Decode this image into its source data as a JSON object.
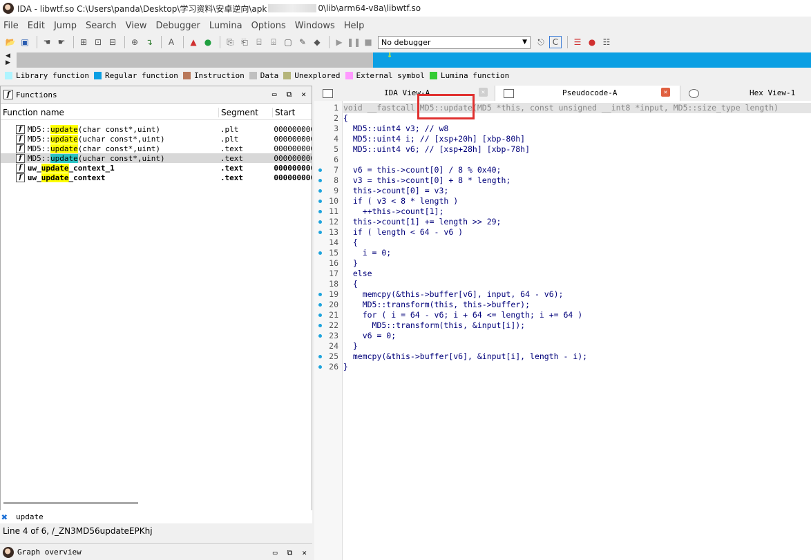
{
  "window": {
    "title": "IDA - libwtf.so C:\\Users\\panda\\Desktop\\学习资料\\安卓逆向\\apk",
    "title_tail": "0\\lib\\arm64-v8a\\libwtf.so"
  },
  "menu": [
    "File",
    "Edit",
    "Jump",
    "Search",
    "View",
    "Debugger",
    "Lumina",
    "Options",
    "Windows",
    "Help"
  ],
  "toolbar": {
    "debugger_select": "No debugger"
  },
  "legend": [
    {
      "label": "Library function",
      "color": "#aef4ff"
    },
    {
      "label": "Regular function",
      "color": "#0b9fe3"
    },
    {
      "label": "Instruction",
      "color": "#b9785a"
    },
    {
      "label": "Data",
      "color": "#c0c0c0"
    },
    {
      "label": "Unexplored",
      "color": "#b5b57a"
    },
    {
      "label": "External symbol",
      "color": "#ff99ff"
    },
    {
      "label": "Lumina function",
      "color": "#33cc33"
    }
  ],
  "functions_panel": {
    "title": "Functions",
    "columns": [
      "Function name",
      "Segment",
      "Start"
    ],
    "rows": [
      {
        "pre": "MD5::",
        "hit": "update",
        "post": "(char const*,uint)",
        "seg": ".plt",
        "start": "0000000000",
        "bold": false,
        "sel": false
      },
      {
        "pre": "MD5::",
        "hit": "update",
        "post": "(uchar const*,uint)",
        "seg": ".plt",
        "start": "0000000000",
        "bold": false,
        "sel": false
      },
      {
        "pre": "MD5::",
        "hit": "update",
        "post": "(char const*,uint)",
        "seg": ".text",
        "start": "0000000000",
        "bold": false,
        "sel": false
      },
      {
        "pre": "MD5::",
        "hit": "update",
        "post": "(uchar const*,uint)",
        "seg": ".text",
        "start": "0000000000",
        "bold": false,
        "sel": true
      },
      {
        "pre": "uw_",
        "hit": "update",
        "post": "_context_1",
        "seg": ".text",
        "start": "0000000000",
        "bold": true,
        "sel": false
      },
      {
        "pre": "uw_",
        "hit": "update",
        "post": "_context",
        "seg": ".text",
        "start": "0000000000",
        "bold": true,
        "sel": false
      }
    ],
    "filter": "update",
    "status": "Line 4 of 6, /_ZN3MD56updateEPKhj"
  },
  "graph_overview": {
    "title": "Graph overview"
  },
  "tabs": [
    {
      "label": "IDA View-A",
      "active": false
    },
    {
      "label": "Pseudocode-A",
      "active": true
    },
    {
      "label": "Hex View-1",
      "active": false
    }
  ],
  "code": [
    {
      "n": "1",
      "d": false,
      "t": "void __fastcall MD5::update(MD5 *this, const unsigned __int8 *input, MD5::size_type length)"
    },
    {
      "n": "2",
      "d": false,
      "t": "{"
    },
    {
      "n": "3",
      "d": false,
      "t": "  MD5::uint4 v3; // w8"
    },
    {
      "n": "4",
      "d": false,
      "t": "  MD5::uint4 i; // [xsp+20h] [xbp-80h]"
    },
    {
      "n": "5",
      "d": false,
      "t": "  MD5::uint4 v6; // [xsp+28h] [xbp-78h]"
    },
    {
      "n": "6",
      "d": false,
      "t": ""
    },
    {
      "n": "7",
      "d": true,
      "t": "  v6 = this->count[0] / 8 % 0x40;"
    },
    {
      "n": "8",
      "d": true,
      "t": "  v3 = this->count[0] + 8 * length;"
    },
    {
      "n": "9",
      "d": true,
      "t": "  this->count[0] = v3;"
    },
    {
      "n": "10",
      "d": true,
      "t": "  if ( v3 < 8 * length )"
    },
    {
      "n": "11",
      "d": true,
      "t": "    ++this->count[1];"
    },
    {
      "n": "12",
      "d": true,
      "t": "  this->count[1] += length >> 29;"
    },
    {
      "n": "13",
      "d": true,
      "t": "  if ( length < 64 - v6 )"
    },
    {
      "n": "14",
      "d": false,
      "t": "  {"
    },
    {
      "n": "15",
      "d": true,
      "t": "    i = 0;"
    },
    {
      "n": "16",
      "d": false,
      "t": "  }"
    },
    {
      "n": "17",
      "d": false,
      "t": "  else"
    },
    {
      "n": "18",
      "d": false,
      "t": "  {"
    },
    {
      "n": "19",
      "d": true,
      "t": "    memcpy(&this->buffer[v6], input, 64 - v6);"
    },
    {
      "n": "20",
      "d": true,
      "t": "    MD5::transform(this, this->buffer);"
    },
    {
      "n": "21",
      "d": true,
      "t": "    for ( i = 64 - v6; i + 64 <= length; i += 64 )"
    },
    {
      "n": "22",
      "d": true,
      "t": "      MD5::transform(this, &input[i]);"
    },
    {
      "n": "23",
      "d": true,
      "t": "    v6 = 0;"
    },
    {
      "n": "24",
      "d": false,
      "t": "  }"
    },
    {
      "n": "25",
      "d": true,
      "t": "  memcpy(&this->buffer[v6], &input[i], length - i);"
    },
    {
      "n": "26",
      "d": true,
      "t": "}"
    }
  ]
}
